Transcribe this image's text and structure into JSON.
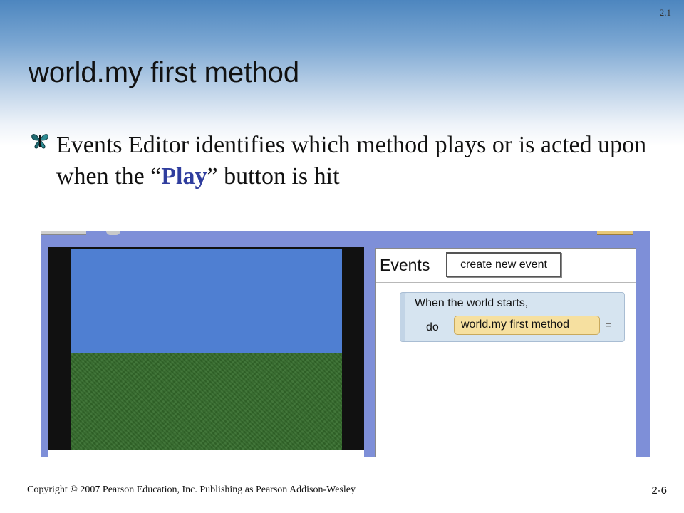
{
  "slide": {
    "section_number": "2.1",
    "title": "world.my first method",
    "bullet": {
      "icon": "butterfly-icon",
      "text_before": "Events Editor identifies which method plays or is acted upon when the “",
      "highlight": "Play",
      "text_after": "” button is hit",
      "highlight_color": "#2f3d9e"
    },
    "footer": {
      "copyright": "Copyright © 2007 Pearson Education, Inc. Publishing as Pearson Addison-Wesley",
      "page_number": "2-6"
    }
  },
  "screenshot": {
    "events_panel": {
      "label": "Events",
      "create_button_label": "create new event",
      "event": {
        "trigger": "When the world starts,",
        "do_label": "do",
        "method": "world.my first method",
        "dropdown": "="
      }
    },
    "colors": {
      "sky": "#4f7fd2",
      "grass": "#356d2c",
      "method_tile": "#f6e0a0",
      "panel_frame": "#7e8fd8"
    }
  }
}
